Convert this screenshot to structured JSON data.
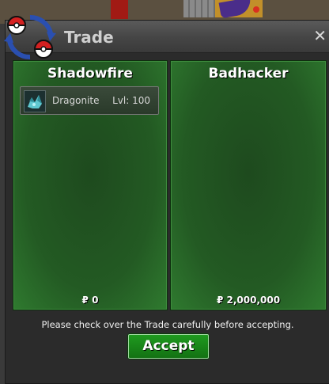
{
  "window": {
    "title": "Trade",
    "close_glyph": "✕",
    "logo_icon": "pokeball-trade-icon"
  },
  "left_panel": {
    "player": "Shadowfire",
    "items": [
      {
        "name": "Dragonite",
        "level": "Lvl: 100",
        "icon": "dragonite-sprite-icon"
      }
    ],
    "money": "₽ 0"
  },
  "right_panel": {
    "player": "Badhacker",
    "items": [],
    "money": "₽ 2,000,000"
  },
  "footer": {
    "notice": "Please check over the Trade carefully before accepting.",
    "accept_label": "Accept"
  },
  "colors": {
    "panel_green": "#235a23",
    "accept_green": "#1f9a1f",
    "titlebar": "#4a4a4a"
  }
}
